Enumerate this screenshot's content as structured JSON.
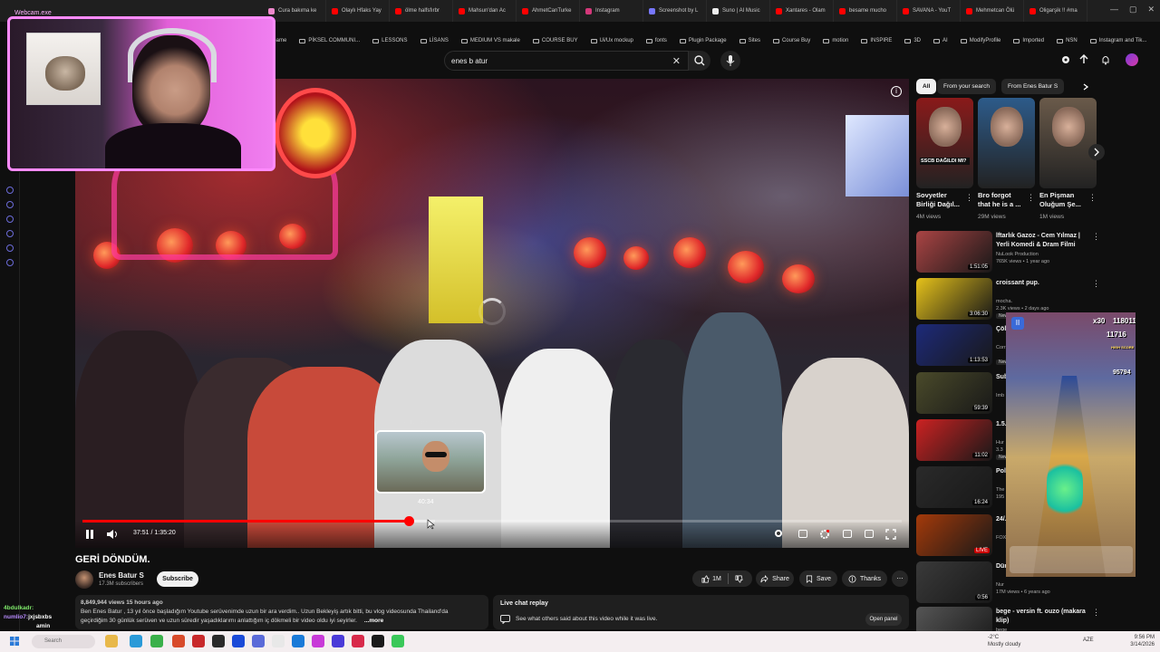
{
  "tabs": [
    {
      "label": "Cura bakıma ke",
      "color": "#e8c"
    },
    {
      "label": "Olaylı Hfaks Yay",
      "color": "#f00"
    },
    {
      "label": "ölme halfsfırbr",
      "color": "#f00"
    },
    {
      "label": "Mahsun'dan Ac",
      "color": "#f00"
    },
    {
      "label": "AhmetCanTurke",
      "color": "#f00"
    },
    {
      "label": "Instagram",
      "color": "#d4387a"
    },
    {
      "label": "Screenshot by L",
      "color": "#77f"
    },
    {
      "label": "Suno | AI Music",
      "color": "#eee"
    },
    {
      "label": "Xantares - Olam",
      "color": "#f00"
    },
    {
      "label": "besame mucho",
      "color": "#f00"
    },
    {
      "label": "SAVANA - YouT",
      "color": "#f00"
    },
    {
      "label": "Mehmetcan Ölü",
      "color": "#f00"
    },
    {
      "label": "Oligarşik !! #ma",
      "color": "#f00"
    }
  ],
  "window_controls": [
    "—",
    "▢",
    "✕"
  ],
  "bookmarks": [
    "Game",
    "PİKSEL COMMUNI...",
    "LESSONS",
    "LİSANS",
    "MEDIUM VS makale",
    "COURSE BUY",
    "Ui/Ux mockup",
    "fonts",
    "Plugin Package",
    "Sites",
    "Course Buy",
    "motion",
    "INSPIRE",
    "3D",
    "AI",
    "ModifyProfile",
    "Imported",
    "NSN",
    "Instagram and Tik..."
  ],
  "search": {
    "query": "enes b atur",
    "clear": "✕"
  },
  "player": {
    "time_current": "37:51",
    "time_total": "1:35:20",
    "seek_time": "40:34",
    "seek_hint": "Pull up for precise seeking",
    "progress_fraction": 0.398,
    "buffer_fraction": 0.43,
    "seek_fraction": 0.425,
    "info_glyph": "i"
  },
  "video": {
    "title": "GERİ DÖNDÜM.",
    "channel": "Enes Batur S",
    "subscribers": "17.3M subscribers",
    "subscribe_label": "Subscribe",
    "likes": "1M",
    "share_label": "Share",
    "save_label": "Save",
    "thanks_label": "Thanks",
    "more_glyph": "⋯"
  },
  "description": {
    "meta": "8,849,944 views  15 hours ago",
    "line1": "Ben Enes Batur , 13 yıl önce başladığım Youtube serüvenimde uzun bir ara verdim.. Uzun Bekleyiş artık bitti, bu vlog videosunda Thailand'da",
    "line2": "geçirdiğim 30 günlük serüven ve uzun süredir yaşadıklarımı anlattığım iç dökmeli bir video oldu iyi seyirler.",
    "more": "...more"
  },
  "live_chat": {
    "title": "Live chat replay",
    "text": "See what others said about this video while it was live.",
    "button": "Open panel"
  },
  "chips": [
    "All",
    "From your search",
    "From Enes Batur S"
  ],
  "shorts": [
    {
      "title": "Sovyetler Birliği Dağıl...",
      "views": "4M views",
      "thumb_text": "SSCB DAĞILDI MI?",
      "bg": "#8a1a1a"
    },
    {
      "title": "Bro forgot that he is a ...",
      "views": "29M views",
      "thumb_text": "",
      "bg": "#2d5b8a"
    },
    {
      "title": "En Pişman Oluğum Şe...",
      "views": "1M views",
      "thumb_text": "",
      "bg": "#6a5a4a"
    }
  ],
  "related": [
    {
      "title": "İftarlık Gazoz - Cem Yılmaz | Yerli Komedi & Dram Filmi İZL...",
      "channel": "NuLook Production",
      "meta": "765K views • 1 year ago",
      "duration": "1:51:05",
      "new": false,
      "bg": "#a44"
    },
    {
      "title": "croissant pup.",
      "channel": "mocha.",
      "meta": "2.3K views • 2 days ago",
      "duration": "3:06:30",
      "new": true,
      "bg": "#e6c21a"
    },
    {
      "title": "Çöl Zey...",
      "channel": "Corr",
      "meta": "",
      "duration": "1:13:53",
      "new": true,
      "bg": "#1d2a7a"
    },
    {
      "title": "Sub Gam...",
      "channel": "Imb",
      "meta": "",
      "duration": "59:39",
      "new": false,
      "bg": "#4a4a2a"
    },
    {
      "title": "1.5...",
      "channel": "Hur",
      "meta": "3.3",
      "duration": "11:02",
      "new": true,
      "bg": "#c22"
    },
    {
      "title": "Poli Rıtü...",
      "channel": "The",
      "meta": "195",
      "duration": "16:24",
      "new": false,
      "bg": "#2a2a2a"
    },
    {
      "title": "24/...",
      "channel": "FOX",
      "meta": "",
      "duration": "LIVE",
      "new": false,
      "bg": "#a43a0a"
    },
    {
      "title": "Dün...",
      "channel": "Nur",
      "meta": "17M views • 6 years ago",
      "duration": "0:56",
      "new": false,
      "bg": "#3a3a3a"
    },
    {
      "title": "bege - versin ft. ouzo (makara klip)",
      "channel": "bege",
      "meta": "",
      "duration": "",
      "new": false,
      "bg": "#555"
    }
  ],
  "game": {
    "score": "1180110",
    "x30": "x30",
    "coins": "11716",
    "hi_score_label": "HIGH SCORE",
    "hi_score": "95794"
  },
  "webcam": {
    "label": "Webcam.exe"
  },
  "chat": [
    {
      "user": "4bdulkadr:",
      "msg": "",
      "color": "#7ee86a"
    },
    {
      "user": "numlio7:",
      "msg": "jxjsbxbs",
      "color": "#b98cff"
    },
    {
      "user": "",
      "msg": "amin",
      "color": "#ffffff"
    }
  ],
  "taskbar": {
    "search_placeholder": "Search",
    "weather_temp": "-2°C",
    "weather_text": "Mostly cloudy",
    "lang": "AZE",
    "time": "9:56 PM",
    "date": "3/14/2026"
  }
}
